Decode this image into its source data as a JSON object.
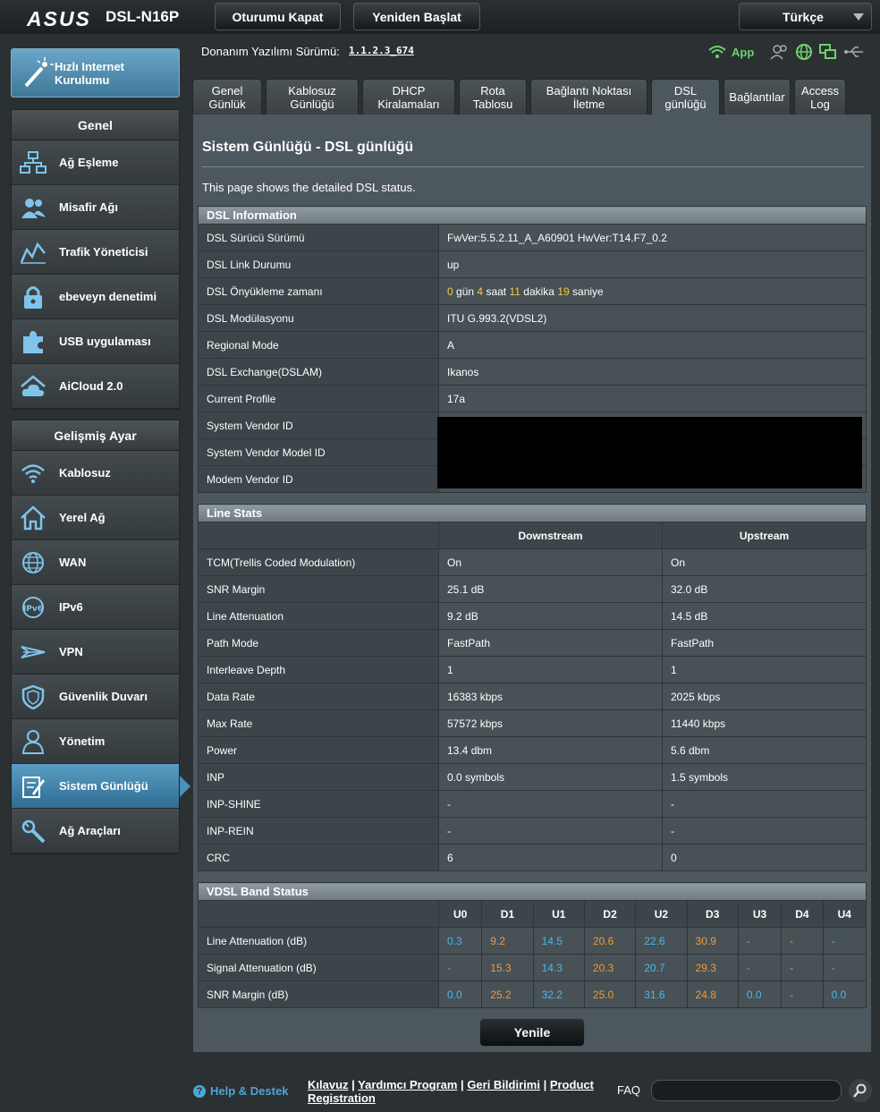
{
  "header": {
    "brand": "ASUS",
    "model": "DSL-N16P",
    "logout_label": "Oturumu Kapat",
    "reboot_label": "Yeniden Başlat",
    "language": "Türkçe",
    "firmware_label": "Donanım Yazılımı Sürümü:",
    "firmware_value": "1.1.2.3_674",
    "app_label": "App"
  },
  "sidebar": {
    "qis_label": "Hızlı Internet Kurulumu",
    "general_title": "Genel",
    "general_items": [
      {
        "label": "Ağ Eşleme",
        "icon": "network-map-icon"
      },
      {
        "label": "Misafir Ağı",
        "icon": "guest-network-icon"
      },
      {
        "label": "Trafik Yöneticisi",
        "icon": "traffic-manager-icon"
      },
      {
        "label": "ebeveyn denetimi",
        "icon": "lock-icon"
      },
      {
        "label": "USB uygulaması",
        "icon": "puzzle-icon"
      },
      {
        "label": "AiCloud 2.0",
        "icon": "cloud-icon"
      }
    ],
    "advanced_title": "Gelişmiş Ayar",
    "advanced_items": [
      {
        "label": "Kablosuz",
        "icon": "wifi-icon"
      },
      {
        "label": "Yerel Ağ",
        "icon": "home-icon"
      },
      {
        "label": "WAN",
        "icon": "globe-icon"
      },
      {
        "label": "IPv6",
        "icon": "ipv6-icon"
      },
      {
        "label": "VPN",
        "icon": "vpn-icon"
      },
      {
        "label": "Güvenlik Duvarı",
        "icon": "shield-icon"
      },
      {
        "label": "Yönetim",
        "icon": "admin-icon"
      },
      {
        "label": "Sistem Günlüğü",
        "icon": "log-icon"
      },
      {
        "label": "Ağ Araçları",
        "icon": "tools-icon"
      }
    ]
  },
  "tabs": [
    {
      "label": "Genel\nGünlük"
    },
    {
      "label": "Kablosuz\nGünlüğü"
    },
    {
      "label": "DHCP\nKiralamaları"
    },
    {
      "label": "Rota\nTablosu"
    },
    {
      "label": "Bağlantı Noktası\nİletme"
    },
    {
      "label": "DSL\ngünlüğü"
    },
    {
      "label": "Bağlantılar"
    },
    {
      "label": "Access\nLog"
    }
  ],
  "page": {
    "title": "Sistem Günlüğü - DSL günlüğü",
    "description": "This page shows the detailed DSL status."
  },
  "dsl_info": {
    "title": "DSL Information",
    "rows": [
      {
        "key": "DSL Sürücü Sürümü",
        "value": "FwVer:5.5.2.11_A_A60901 HwVer:T14.F7_0.2"
      },
      {
        "key": "DSL Link Durumu",
        "value": "up"
      },
      {
        "key": "DSL Önyükleme zamanı",
        "value": ""
      },
      {
        "key": "DSL Modülasyonu",
        "value": "ITU G.993.2(VDSL2)"
      },
      {
        "key": "Regional Mode",
        "value": "A"
      },
      {
        "key": "DSL Exchange(DSLAM)",
        "value": "Ikanos"
      },
      {
        "key": "Current Profile",
        "value": "17a"
      },
      {
        "key": "System Vendor ID",
        "value": ""
      },
      {
        "key": "System Vendor Model ID",
        "value": ""
      },
      {
        "key": "Modem Vendor ID",
        "value": ""
      }
    ],
    "uptime": {
      "days": "0",
      "days_unit": "gün",
      "hours": "4",
      "hours_unit": "saat",
      "minutes": "11",
      "minutes_unit": "dakika",
      "seconds": "19",
      "seconds_unit": "saniye"
    }
  },
  "line_stats": {
    "title": "Line Stats",
    "col_down": "Downstream",
    "col_up": "Upstream",
    "rows": [
      {
        "key": "TCM(Trellis Coded Modulation)",
        "down": "On",
        "up": "On"
      },
      {
        "key": "SNR Margin",
        "down": "25.1 dB",
        "up": "32.0 dB"
      },
      {
        "key": "Line Attenuation",
        "down": "9.2 dB",
        "up": "14.5 dB"
      },
      {
        "key": "Path Mode",
        "down": "FastPath",
        "up": "FastPath"
      },
      {
        "key": "Interleave Depth",
        "down": "1",
        "up": "1"
      },
      {
        "key": "Data Rate",
        "down": "16383 kbps",
        "up": "2025 kbps"
      },
      {
        "key": "Max Rate",
        "down": "57572 kbps",
        "up": "11440 kbps"
      },
      {
        "key": "Power",
        "down": "13.4 dbm",
        "up": "5.6 dbm"
      },
      {
        "key": "INP",
        "down": "0.0 symbols",
        "up": "1.5 symbols"
      },
      {
        "key": "INP-SHINE",
        "down": "-",
        "up": "-"
      },
      {
        "key": "INP-REIN",
        "down": "-",
        "up": "-"
      },
      {
        "key": "CRC",
        "down": "6",
        "up": "0"
      }
    ]
  },
  "vdsl_band": {
    "title": "VDSL Band Status",
    "bands": [
      "U0",
      "D1",
      "U1",
      "D2",
      "U2",
      "D3",
      "U3",
      "D4",
      "U4"
    ],
    "rows": [
      {
        "key": "Line Attenuation (dB)",
        "values": [
          "0.3",
          "9.2",
          "14.5",
          "20.6",
          "22.6",
          "30.9",
          "-",
          "-",
          "-"
        ]
      },
      {
        "key": "Signal Attenuation (dB)",
        "values": [
          "-",
          "15.3",
          "14.3",
          "20.3",
          "20.7",
          "29.3",
          "-",
          "-",
          "-"
        ]
      },
      {
        "key": "SNR Margin (dB)",
        "values": [
          "0.0",
          "25.2",
          "32.2",
          "25.0",
          "31.6",
          "24.8",
          "0.0",
          "-",
          "0.0"
        ]
      }
    ],
    "upstream_color": "#4cb7ec",
    "downstream_color": "#f29a3c"
  },
  "refresh_label": "Yenile",
  "footer": {
    "help_label": "Help & Destek",
    "link1": "Kılavuz",
    "link2": "Yardımcı Program",
    "link3": "Geri Bildirimi",
    "link4": "Product Registration",
    "faq_label": "FAQ"
  }
}
